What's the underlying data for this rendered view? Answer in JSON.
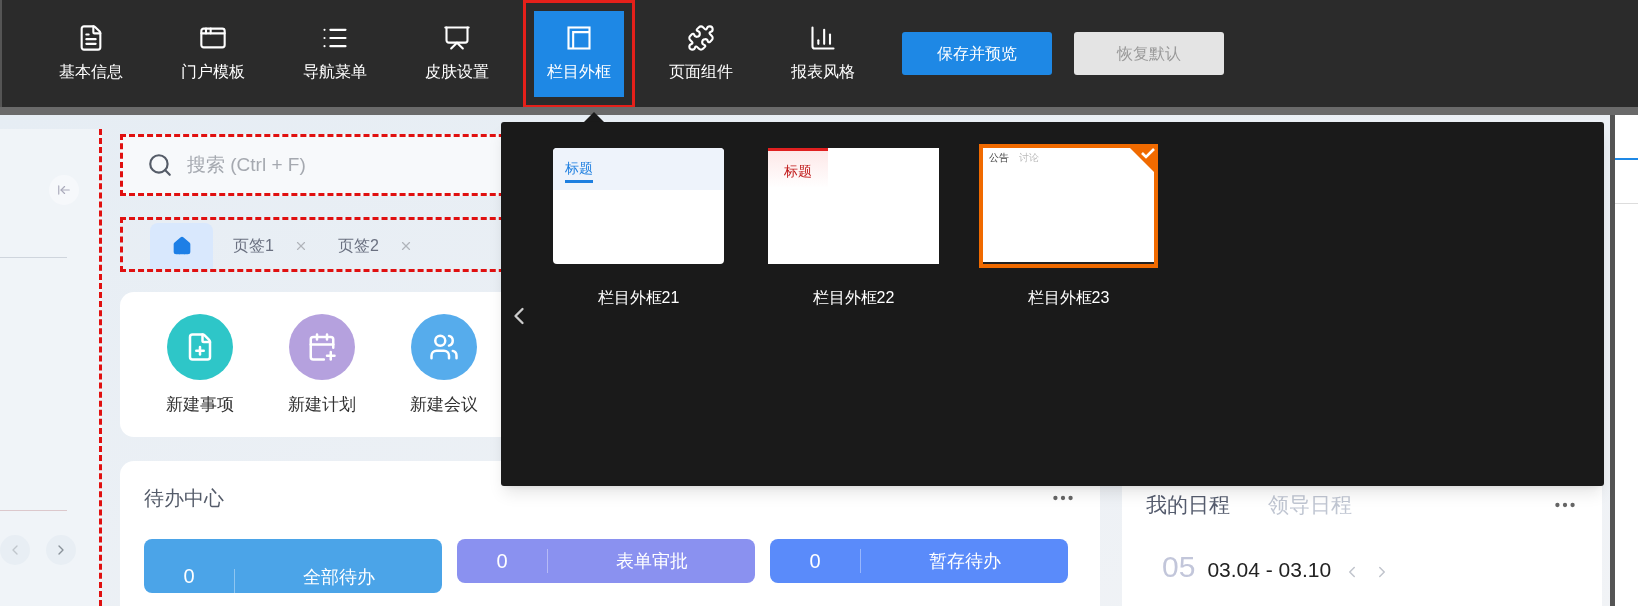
{
  "toolbar": {
    "items": [
      {
        "label": "基本信息",
        "selected": false
      },
      {
        "label": "门户模板",
        "selected": false
      },
      {
        "label": "导航菜单",
        "selected": false
      },
      {
        "label": "皮肤设置",
        "selected": false
      },
      {
        "label": "栏目外框",
        "selected": true
      },
      {
        "label": "页面组件",
        "selected": false
      },
      {
        "label": "报表风格",
        "selected": false
      }
    ],
    "buttons": [
      {
        "label": "保存并预览",
        "disabled": false
      },
      {
        "label": "恢复默认",
        "disabled": true
      }
    ]
  },
  "search": {
    "placeholder": "搜索 (Ctrl + F)"
  },
  "tabs": [
    {
      "kind": "home",
      "selected": true
    },
    {
      "kind": "page",
      "label": "页签1",
      "selected": false
    },
    {
      "kind": "page",
      "label": "页签2",
      "selected": false
    }
  ],
  "quick_actions": [
    {
      "label": "新建事项",
      "color": "#2ec6c8"
    },
    {
      "label": "新建计划",
      "color": "#b5a1de"
    },
    {
      "label": "新建会议",
      "color": "#56acec"
    }
  ],
  "frame_popup": {
    "items": [
      {
        "label": "栏目外框21",
        "kind": "blue-title",
        "preview": [
          "标题"
        ],
        "selected": false
      },
      {
        "label": "栏目外框22",
        "kind": "red-title",
        "preview": [
          "标题"
        ],
        "selected": false
      },
      {
        "label": "栏目外框23",
        "kind": "tabs",
        "preview": [
          "公告",
          "讨论"
        ],
        "selected": true
      }
    ]
  },
  "todo": {
    "title": "待办中心",
    "cards": [
      {
        "count": "0",
        "label": "全部待办",
        "color": "#4ba4e8"
      },
      {
        "count": "0",
        "label": "表单审批",
        "color": "#8a91f0"
      },
      {
        "count": "0",
        "label": "暂存待办",
        "color": "#5a8bfa"
      }
    ]
  },
  "schedule": {
    "tabs": [
      {
        "label": "我的日程",
        "selected": true
      },
      {
        "label": "领导日程",
        "selected": false
      }
    ],
    "week": "05",
    "range": "03.04 - 03.10"
  }
}
